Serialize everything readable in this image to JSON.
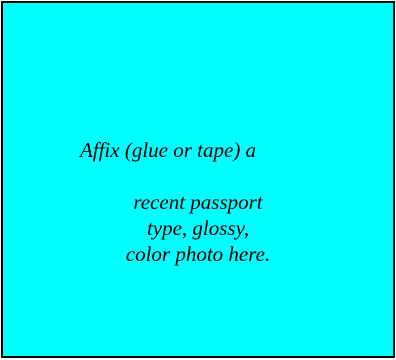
{
  "photo_box": {
    "background": "#00ffff",
    "border_color": "#000000",
    "lines": [
      "Affix (glue or tape) a",
      "recent passport",
      "type, glossy,",
      "color photo here."
    ]
  }
}
